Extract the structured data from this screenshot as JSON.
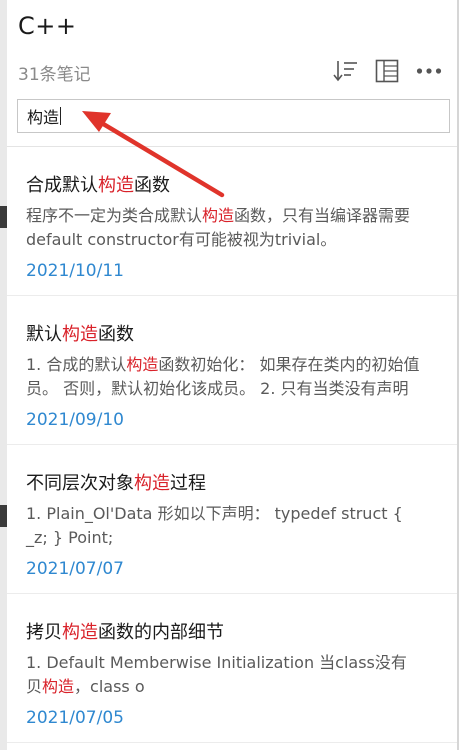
{
  "notebook": {
    "title": "C++",
    "count_label": "31条笔记"
  },
  "toolbar": {
    "sort_icon": "sort-icon",
    "grid_icon": "grid-view-icon",
    "more_icon": "more-icon"
  },
  "search": {
    "value": "构造"
  },
  "notes": [
    {
      "title_pre": "合成默认",
      "title_hl": "构造",
      "title_post": "函数",
      "line1_pre": "  程序不一定为类合成默认",
      "line1_hl": "构造",
      "line1_post": "函数，只有当编译器需要",
      "line2_pre": "default constructor有可能被视为trivial。",
      "line2_hl": "",
      "line2_post": "",
      "date": "2021/10/11"
    },
    {
      "title_pre": "默认",
      "title_hl": "构造",
      "title_post": "函数",
      "line1_pre": "1. 合成的默认",
      "line1_hl": "构造",
      "line1_post": "函数初始化：  如果存在类内的初始值",
      "line2_pre": "员。 否则，默认初始化该成员。   2. 只有当类没有声明",
      "line2_hl": "",
      "line2_post": "",
      "date": "2021/09/10"
    },
    {
      "title_pre": "不同层次对象",
      "title_hl": "构造",
      "title_post": "过程",
      "line1_pre": "1. Plain_Ol'Data      形如以下声明：  typedef struct {",
      "line1_hl": "",
      "line1_post": "",
      "line2_pre": "_z; } Point;",
      "line2_hl": "",
      "line2_post": "",
      "date": "2021/07/07"
    },
    {
      "title_pre": "拷贝",
      "title_hl": "构造",
      "title_post": "函数的内部细节",
      "line1_pre": "1. Default Memberwise Initialization      当class没有",
      "line1_hl": "",
      "line1_post": "",
      "line2_pre": "贝",
      "line2_hl": "构造",
      "line2_post": "，class o",
      "date": "2021/07/05"
    }
  ],
  "colors": {
    "highlight": "#d9222a",
    "date": "#2f88d0",
    "annotation_arrow": "#e0342b"
  }
}
